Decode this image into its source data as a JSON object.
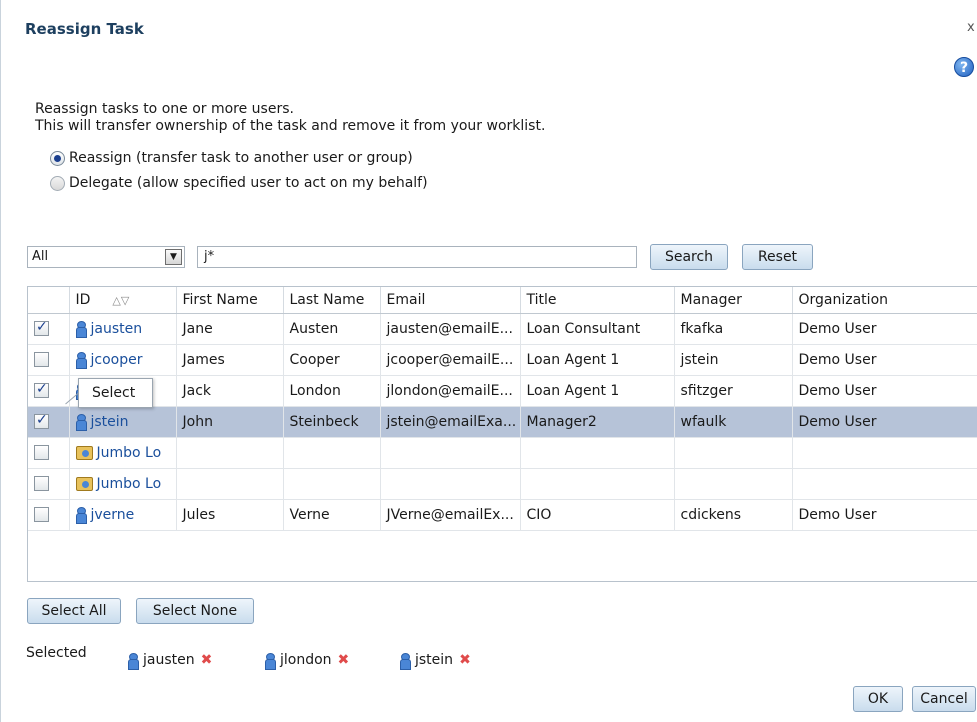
{
  "dialog": {
    "title": "Reassign Task",
    "close_glyph": "x",
    "help_glyph": "?",
    "description_line1": "Reassign tasks to one or more users.",
    "description_line2": "This will transfer ownership of the task and remove it from your worklist."
  },
  "mode": {
    "reassign_label": "Reassign (transfer task to another user or group)",
    "delegate_label": "Delegate (allow specified user to act on my behalf)",
    "selected": "reassign"
  },
  "search": {
    "filter_value": "All",
    "query_value": "j*",
    "search_label": "Search",
    "reset_label": "Reset"
  },
  "table": {
    "columns": [
      "ID",
      "First Name",
      "Last Name",
      "Email",
      "Title",
      "Manager",
      "Organization"
    ],
    "rows": [
      {
        "checked": true,
        "type": "user",
        "id": "jausten",
        "first": "Jane",
        "last": "Austen",
        "email": "jausten@emailE...",
        "title": "Loan Consultant",
        "manager": "fkafka",
        "org": "Demo User"
      },
      {
        "checked": false,
        "type": "user",
        "id": "jcooper",
        "first": "James",
        "last": "Cooper",
        "email": "jcooper@emailE...",
        "title": "Loan Agent 1",
        "manager": "jstein",
        "org": "Demo User"
      },
      {
        "checked": true,
        "type": "user",
        "id": "",
        "first": "Jack",
        "last": "London",
        "email": "jlondon@emailE...",
        "title": "Loan Agent 1",
        "manager": "sfitzger",
        "org": "Demo User"
      },
      {
        "checked": true,
        "type": "user",
        "id": "jstein",
        "first": "John",
        "last": "Steinbeck",
        "email": "jstein@emailExa...",
        "title": "Manager2",
        "manager": "wfaulk",
        "org": "Demo User",
        "highlighted": true
      },
      {
        "checked": false,
        "type": "group",
        "id": "Jumbo Lo",
        "first": "",
        "last": "",
        "email": "",
        "title": "",
        "manager": "",
        "org": ""
      },
      {
        "checked": false,
        "type": "group",
        "id": "Jumbo Lo",
        "first": "",
        "last": "",
        "email": "",
        "title": "",
        "manager": "",
        "org": ""
      },
      {
        "checked": false,
        "type": "user",
        "id": "jverne",
        "first": "Jules",
        "last": "Verne",
        "email": "JVerne@emailEx...",
        "title": "CIO",
        "manager": "cdickens",
        "org": "Demo User"
      }
    ],
    "tooltip": "Select"
  },
  "footer": {
    "select_all_label": "Select All",
    "select_none_label": "Select None",
    "selected_label": "Selected",
    "selected_users": [
      "jausten",
      "jlondon",
      "jstein"
    ],
    "ok_label": "OK",
    "cancel_label": "Cancel"
  }
}
